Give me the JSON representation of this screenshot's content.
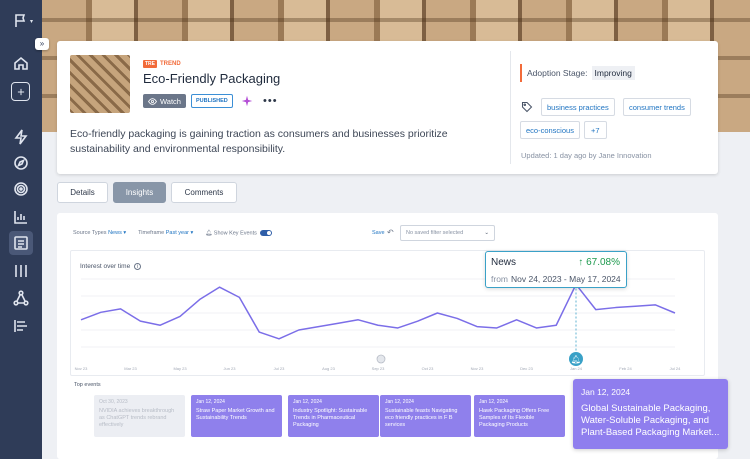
{
  "sidebar": {
    "collapse_glyph": "»",
    "icons": [
      "flag-icon",
      "home-icon",
      "plus-icon",
      "bolt-icon",
      "compass-icon",
      "target-icon",
      "bar-chart-icon",
      "list-icon",
      "columns-icon",
      "network-icon",
      "align-icon"
    ]
  },
  "header": {
    "tag_badge": "TRE",
    "tag_label": "TREND",
    "title": "Eco-Friendly Packaging",
    "watch_label": "Watch",
    "status_label": "PUBLISHED",
    "more_glyph": "•••",
    "description": "Eco-friendly packaging is gaining traction as consumers and businesses prioritize sustainability and environmental responsibility.",
    "adoption_label": "Adoption Stage:",
    "adoption_value": "Improving",
    "tags": [
      "business practices",
      "consumer trends",
      "eco-conscious"
    ],
    "tags_more": "+7",
    "updated": "Updated: 1 day ago by Jane Innovation"
  },
  "tabs": [
    "Details",
    "Insights",
    "Comments"
  ],
  "active_tab": "Insights",
  "filters": {
    "source_label": "Source Types",
    "source_value": "News",
    "timeframe_label": "Timeframe",
    "timeframe_value": "Past year",
    "key_events_label": "Show Key Events",
    "save_label": "Save",
    "saved_filter_placeholder": "No saved filter selected"
  },
  "chart_data": {
    "type": "line",
    "title": "Interest over time",
    "x": [
      "Nov 23",
      "Dec 23",
      "Jan 24",
      "Feb 24",
      "Mar 24",
      "Apr 24",
      "May 24",
      "Jun 24",
      "Jul 24",
      "Aug 24",
      "Sep 24",
      "Oct 24",
      "Nov 24",
      "Dec 24",
      "Jan 25",
      "Feb 25",
      "Mar 25",
      "Apr 25",
      "May 25",
      "Jun 25",
      "Jul 25",
      "Aug 25",
      "Sep 25",
      "Oct 25",
      "Nov 25"
    ],
    "tick_labels": [
      "Nov 23",
      "",
      "Mar 23",
      "",
      "May 23",
      "",
      "Jun 23",
      "",
      "Jul 23",
      "",
      "Aug 23",
      "",
      "Sep 23",
      "",
      "Oct 23",
      "",
      "Nov 23",
      "",
      "Dec 23",
      "",
      "Jan 24",
      "",
      "Feb 24",
      "",
      "Jul 24"
    ],
    "series": [
      {
        "name": "News",
        "values": [
          40,
          51,
          56,
          38,
          32,
          45,
          70,
          88,
          73,
          22,
          12,
          25,
          30,
          35,
          40,
          32,
          28,
          38,
          50,
          42,
          30,
          28,
          40,
          28,
          32,
          92,
          55,
          58,
          60,
          62,
          50
        ],
        "color": "#7b6ee8"
      }
    ],
    "ylim": [
      0,
      100
    ],
    "tooltip": {
      "series": "News",
      "change": "↑ 67.08%",
      "from_label": "from",
      "range": "Nov 24, 2023 - May 17, 2024"
    }
  },
  "top_events_label": "Top events",
  "events": [
    {
      "date": "Oct 30, 2023",
      "title": "NVIDIA achieves breakthrough as ChatGPT trends rebrand effectively",
      "faded": true
    },
    {
      "date": "Jan 12, 2024",
      "title": "Straw Paper Market Growth and Sustainability Trends",
      "faded": false
    },
    {
      "date": "Jan 12, 2024",
      "title": "Industry Spotlight: Sustainable Trends in Pharmaceutical Packaging",
      "faded": false
    },
    {
      "date": "Jan 12, 2024",
      "title": "Sustainable feasts Navigating eco friendly practices in F B services",
      "faded": false
    },
    {
      "date": "Jan 12, 2024",
      "title": "Hawk Packaging Offers Free Samples of Its Flexible Packaging Products",
      "faded": false
    }
  ],
  "featured_event": {
    "date": "Jan 12, 2024",
    "title": "Global Sustainable Packaging, Water-Soluble Packaging, and Plant-Based Packaging Market..."
  }
}
